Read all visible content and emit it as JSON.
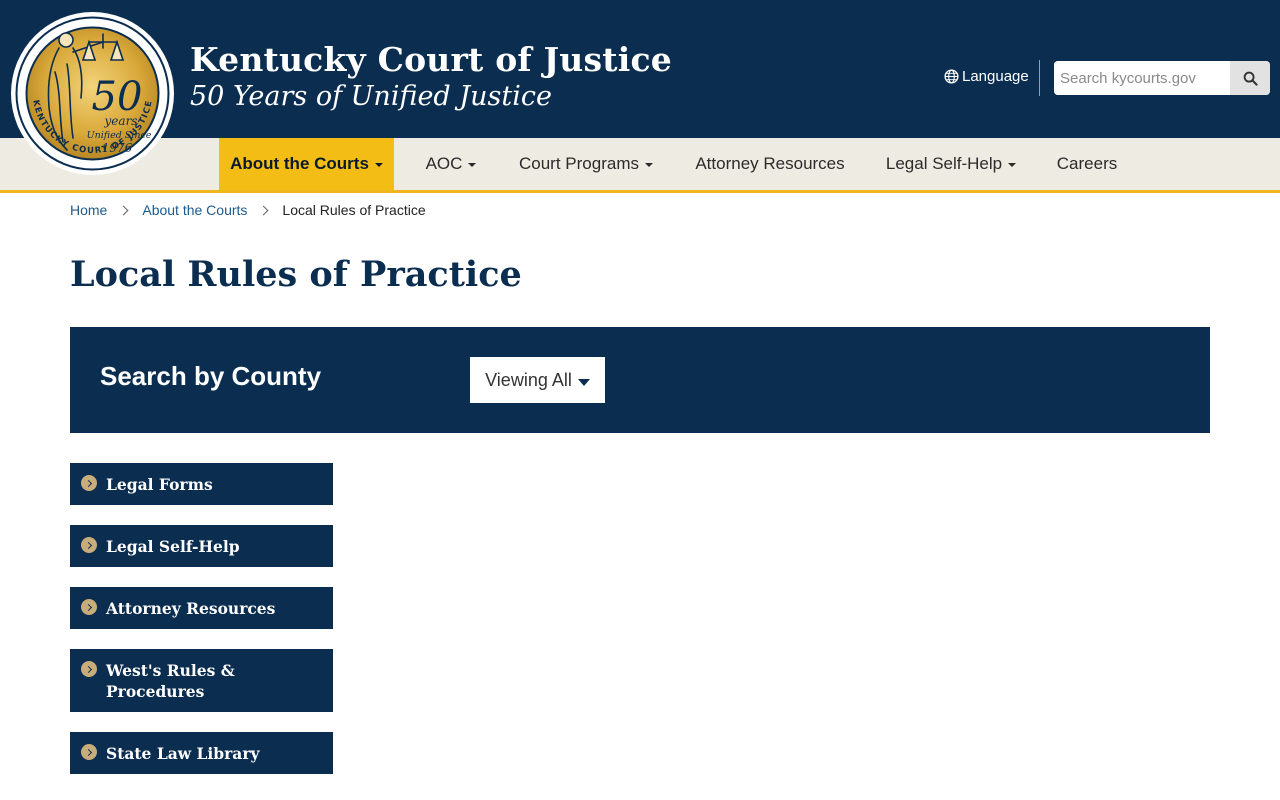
{
  "header": {
    "title": "Kentucky Court of Justice",
    "subtitle": "50 Years of Unified Justice",
    "seal": {
      "ring_text": "KENTUCKY COURT OF JUSTICE",
      "number": "50",
      "years": "years",
      "unified_since": "Unified Since",
      "year": "1976"
    },
    "language_label": "Language",
    "search_placeholder": "Search kycourts.gov"
  },
  "nav": {
    "items": [
      {
        "label": "About the Courts",
        "dropdown": true,
        "active": true
      },
      {
        "label": "AOC",
        "dropdown": true
      },
      {
        "label": "Court Programs",
        "dropdown": true
      },
      {
        "label": "Attorney Resources",
        "dropdown": false
      },
      {
        "label": "Legal Self-Help",
        "dropdown": true
      },
      {
        "label": "Careers",
        "dropdown": false
      }
    ]
  },
  "breadcrumb": {
    "home": "Home",
    "parent": "About the Courts",
    "current": "Local Rules of Practice"
  },
  "page": {
    "title": "Local Rules of Practice"
  },
  "county_search": {
    "label": "Search by County",
    "selected": "Viewing All"
  },
  "side_links": [
    {
      "label": "Legal Forms"
    },
    {
      "label": "Legal Self-Help"
    },
    {
      "label": "Attorney Resources"
    },
    {
      "label": "West's Rules & Procedures"
    },
    {
      "label": "State Law Library"
    }
  ],
  "colors": {
    "navy": "#0b2d50",
    "gold": "#f4bd16",
    "nav_bg": "#eeebe3",
    "link": "#1d5b8c",
    "chevron": "#c8ac79"
  }
}
